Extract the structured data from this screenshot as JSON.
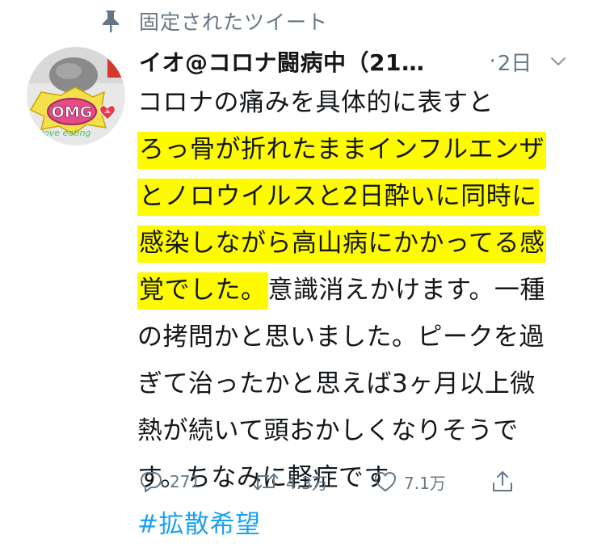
{
  "pinned": {
    "label": "固定されたツイート",
    "icon": "pin-icon"
  },
  "avatar": {
    "badge_text": "OMG",
    "caption": "love eating"
  },
  "header": {
    "display_name": "イオ@コロナ闘病中（21…",
    "separator": "·",
    "timestamp": "2日",
    "menu_icon": "chevron-down-icon"
  },
  "tweet": {
    "line1": "コロナの痛みを具体的に表すと",
    "line2": "ろっ骨が折れたままインフルエンザ",
    "line3": "とノロウイルスと2日酔いに同時に",
    "line4": "感染しながら高山病にかかってる感",
    "line5_highlight": "覚でした。",
    "line5_rest": "意識消えかけます。一種",
    "line6": "の拷問かと思いました。ピークを過",
    "line7": "ぎて治ったかと思えば3ヶ月以上微",
    "line8": "熱が続いて頭おかしくなりそうで",
    "line9": "す。ちなみに軽症です",
    "hashtag": "#拡散希望"
  },
  "actions": {
    "reply": {
      "icon": "reply-icon",
      "count": "271"
    },
    "retweet": {
      "icon": "retweet-icon",
      "count": "4.3万"
    },
    "like": {
      "icon": "heart-icon",
      "count": "7.1万"
    },
    "share": {
      "icon": "share-icon"
    }
  },
  "colors": {
    "text": "#14171a",
    "secondary": "#657786",
    "highlight": "#fefa00",
    "hashtag": "#1da1f2"
  }
}
